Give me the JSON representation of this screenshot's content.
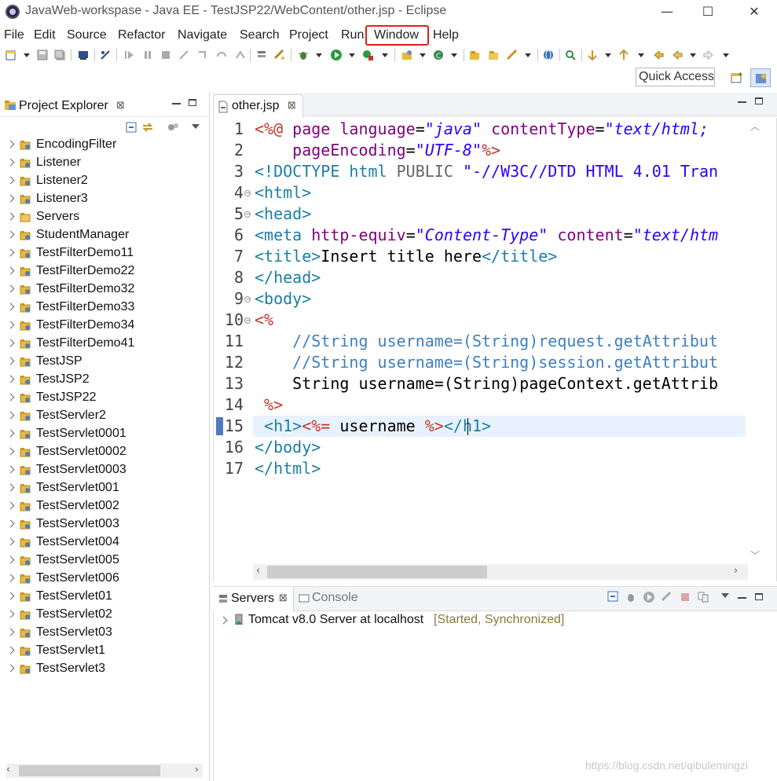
{
  "window": {
    "title": "JavaWeb-workspase - Java EE - TestJSP22/WebContent/other.jsp - Eclipse",
    "minimize": "—",
    "maximize": "☐",
    "close": "✕"
  },
  "menubar": {
    "items": [
      "File",
      "Edit",
      "Source",
      "Refactor",
      "Navigate",
      "Search",
      "Project",
      "Run",
      "Window",
      "Help"
    ],
    "highlighted": "Window",
    "highlight_color": "#e0201a"
  },
  "toolbar": {
    "quick_access": "Quick Access"
  },
  "explorer": {
    "title": "Project Explorer",
    "close": "⊠",
    "projects": [
      "EncodingFilter",
      "Listener",
      "Listener2",
      "Listener3",
      "Servers",
      "StudentManager",
      "TestFilterDemo11",
      "TestFilterDemo22",
      "TestFilterDemo32",
      "TestFilterDemo33",
      "TestFilterDemo34",
      "TestFilterDemo41",
      "TestJSP",
      "TestJSP2",
      "TestJSP22",
      "TestServler2",
      "TestServlet0001",
      "TestServlet0002",
      "TestServlet0003",
      "TestServlet001",
      "TestServlet002",
      "TestServlet003",
      "TestServlet004",
      "TestServlet005",
      "TestServlet006",
      "TestServlet01",
      "TestServlet02",
      "TestServlet03",
      "TestServlet1",
      "TestServlet3"
    ]
  },
  "editor": {
    "tab_title": "other.jsp",
    "close": "⊠",
    "current_line": 15,
    "lines": [
      {
        "n": "1",
        "html": "<span class='kw-delim'>&lt;%@</span> <span class='kw-attr'>page</span> <span class='kw-attr'>language</span>=<span class='kw-str'>\"java\"</span> <span class='kw-attr'>contentType</span>=<span class='kw-str'>\"text/html;</span>"
      },
      {
        "n": "",
        "html": "    <span class='kw-attr'>pageEncoding</span>=<span class='kw-str'>\"UTF-8\"</span><span class='kw-delim'>%&gt;</span>"
      },
      {
        "n": "3",
        "html": "<span class='kw-doctype'>&lt;!DOCTYPE</span> <span class='kw-doctype'>html</span> <span style='color:#666'>PUBLIC</span> <span class='kw-str' style='font-style:normal;color:#2a00ff'>\"-//W3C//DTD HTML 4.01 Tran</span>"
      },
      {
        "n": "4",
        "html": "<span class='kw-tag'>&lt;html&gt;</span>"
      },
      {
        "n": "5",
        "html": "<span class='kw-tag'>&lt;head&gt;</span>"
      },
      {
        "n": "6",
        "html": "<span class='kw-tag'>&lt;meta</span> <span class='kw-attr'>http-equiv</span>=<span class='kw-str'>\"Content-Type\"</span> <span class='kw-attr'>content</span>=<span class='kw-str'>\"text/htm</span>"
      },
      {
        "n": "7",
        "html": "<span class='kw-tag'>&lt;title&gt;</span>Insert title here<span class='kw-tag'>&lt;/title&gt;</span>"
      },
      {
        "n": "8",
        "html": "<span class='kw-tag'>&lt;/head&gt;</span>"
      },
      {
        "n": "9",
        "html": "<span class='kw-tag'>&lt;body&gt;</span>"
      },
      {
        "n": "10",
        "html": "<span class='kw-delim'>&lt;%</span>"
      },
      {
        "n": "11",
        "html": "    <span class='kw-comment'>//String username=(String)request.getAttribut</span>"
      },
      {
        "n": "12",
        "html": "    <span class='kw-comment'>//String username=(String)session.getAttribut</span>"
      },
      {
        "n": "13",
        "html": "    String username=(String)pageContext.getAttrib"
      },
      {
        "n": "14",
        "html": " <span class='kw-delim'>%&gt;</span>"
      },
      {
        "n": "15",
        "html": " <span class='kw-tag'>&lt;h1&gt;</span><span class='kw-delim'>&lt;%=</span> username <span class='kw-delim'>%&gt;</span><span class='kw-tag'>&lt;/h1&gt;</span>"
      },
      {
        "n": "16",
        "html": "<span class='kw-tag'>&lt;/body&gt;</span>"
      },
      {
        "n": "17",
        "html": "<span class='kw-tag'>&lt;/html&gt;</span>"
      }
    ]
  },
  "servers_panel": {
    "tab_servers": "Servers",
    "tab_console": "Console",
    "close": "⊠",
    "entry_name": "Tomcat v8.0 Server at localhost",
    "entry_status": "[Started, Synchronized]",
    "status_color": "#8c7a3a"
  },
  "watermark": "https://blog.csdn.net/qibulemingzi"
}
